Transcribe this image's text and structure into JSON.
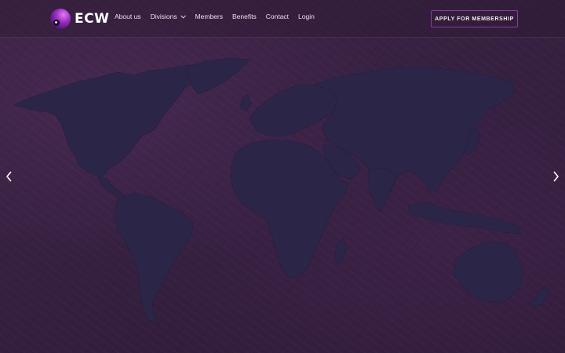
{
  "brand": {
    "name": "ECW",
    "logo_icon": "purple-sphere-icon"
  },
  "nav": {
    "items": [
      {
        "label": "About us"
      },
      {
        "label": "Divisions",
        "has_dropdown": true
      },
      {
        "label": "Members"
      },
      {
        "label": "Benefits"
      },
      {
        "label": "Contact"
      },
      {
        "label": "Login"
      }
    ]
  },
  "cta": {
    "label": "APPLY FOR MEMBERSHIP"
  },
  "carousel": {
    "prev_icon": "chevron-left-icon",
    "next_icon": "chevron-right-icon"
  },
  "colors": {
    "background": "#3a2240",
    "map_land": "#2a2547",
    "accent": "#8a3fa3",
    "text": "#ecdff0"
  }
}
